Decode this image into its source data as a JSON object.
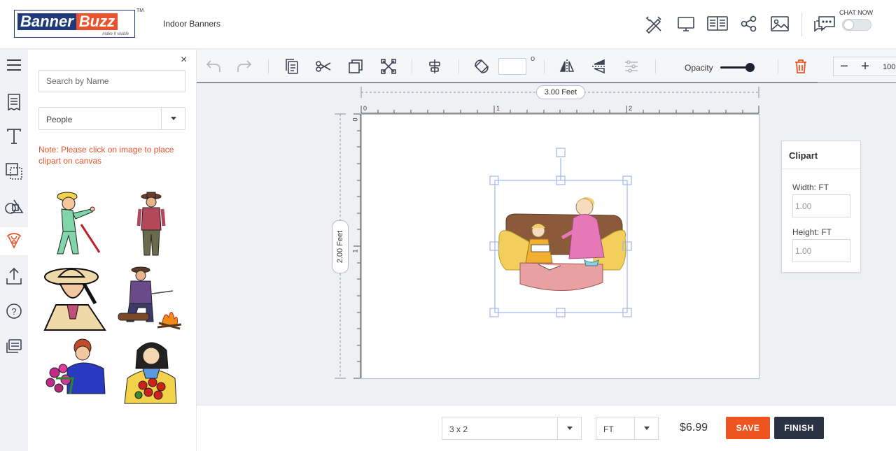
{
  "header": {
    "logo": {
      "part1": "Banner",
      "part2": "Buzz",
      "tagline": "make it visible",
      "tm": "TM"
    },
    "page_title": "Indoor Banners",
    "icons": [
      "design-tools-icon",
      "desktop-preview-icon",
      "product-info-icon",
      "share-icon",
      "image-icon",
      "chat-icon"
    ],
    "chat_label": "CHAT NOW"
  },
  "rail": {
    "items": [
      "menu-icon",
      "templates-icon",
      "text-icon",
      "backgrounds-icon",
      "shapes-icon",
      "clipart-icon",
      "upload-icon",
      "help-icon",
      "layers-icon"
    ],
    "active": "clipart-icon"
  },
  "panel": {
    "close": "×",
    "search_placeholder": "Search by Name",
    "category": "People",
    "note": "Note: Please click on image to place clipart on canvas",
    "cliparts": [
      "man-with-cane",
      "cowboy-standing",
      "cowboy-portrait",
      "man-by-campfire",
      "woman-with-flowers",
      "woman-with-roses"
    ]
  },
  "toolbar": {
    "rotation_value": "",
    "degree_symbol": "o",
    "opacity_label": "Opacity",
    "opacity": 1.0,
    "zoom_minus": "−",
    "zoom_plus": "+",
    "zoom_value": "100"
  },
  "canvas": {
    "width_label": "3.00 Feet",
    "height_label": "2.00 Feet",
    "ruler_x": [
      "0",
      "1",
      "2"
    ],
    "ruler_y": [
      "0",
      "1"
    ],
    "selected_clipart": "mother-reading-to-child"
  },
  "clipart_panel": {
    "title": "Clipart",
    "width_label": "Width: FT",
    "width_value": "1.00",
    "height_label": "Height: FT",
    "height_value": "1.00"
  },
  "bottom": {
    "size": "3 x 2",
    "unit": "FT",
    "price": "$6.99",
    "save_label": "SAVE",
    "finish_label": "FINISH"
  },
  "colors": {
    "accent_orange": "#ee5420",
    "dark_navy": "#2b3244",
    "brand_blue": "#1f3a7a",
    "selection_blue": "#9fb8e8"
  }
}
